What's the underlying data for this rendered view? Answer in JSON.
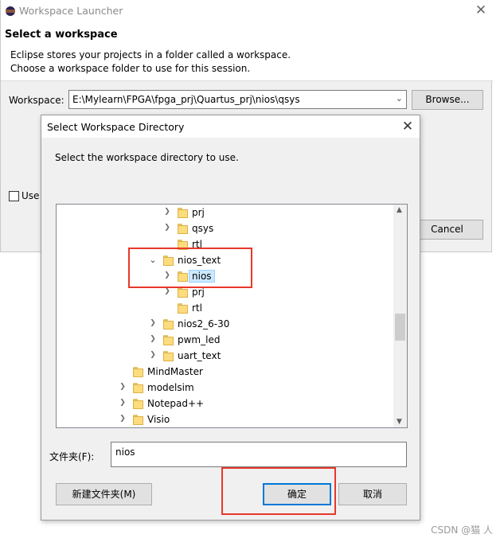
{
  "launcher": {
    "title": "Workspace Launcher",
    "close_glyph": "✕",
    "heading": "Select a workspace",
    "description_line1": "Eclipse stores your projects in a folder called a workspace.",
    "description_line2": "Choose a workspace folder to use for this session.",
    "workspace_label": "Workspace:",
    "workspace_value": "E:\\Mylearn\\FPGA\\fpga_prj\\Quartus_prj\\nios\\qsys",
    "browse_label": "Browse...",
    "use_default_label": "Use",
    "cancel_label": "Cancel",
    "icon": "eclipse-icon"
  },
  "dialog": {
    "title": "Select Workspace Directory",
    "close_glyph": "✕",
    "instruction": "Select the workspace directory to use.",
    "tree": [
      {
        "label": "prj",
        "expanded": false
      },
      {
        "label": "qsys",
        "expanded": false
      },
      {
        "label": "rtl",
        "expanded": false
      },
      {
        "label": "nios_text",
        "expanded": true
      },
      {
        "label": "nios",
        "expanded": false,
        "selected": true
      },
      {
        "label": "prj",
        "expanded": false
      },
      {
        "label": "rtl",
        "expanded": false
      },
      {
        "label": "nios2_6-30",
        "expanded": false
      },
      {
        "label": "pwm_led",
        "expanded": false
      },
      {
        "label": "uart_text",
        "expanded": false
      },
      {
        "label": "MindMaster",
        "expanded": false
      },
      {
        "label": "modelsim",
        "expanded": false
      },
      {
        "label": "Notepad++",
        "expanded": false
      },
      {
        "label": "Visio",
        "expanded": false
      }
    ],
    "folder_label": "文件夹(F):",
    "folder_value": "nios",
    "new_folder_label": "新建文件夹(M)",
    "ok_label": "确定",
    "cancel_label": "取消"
  },
  "watermark": "CSDN @猫 人",
  "colors": {
    "highlight_box": "#e8382a",
    "selection_bg": "#cce8ff",
    "ok_border": "#0078d7"
  }
}
